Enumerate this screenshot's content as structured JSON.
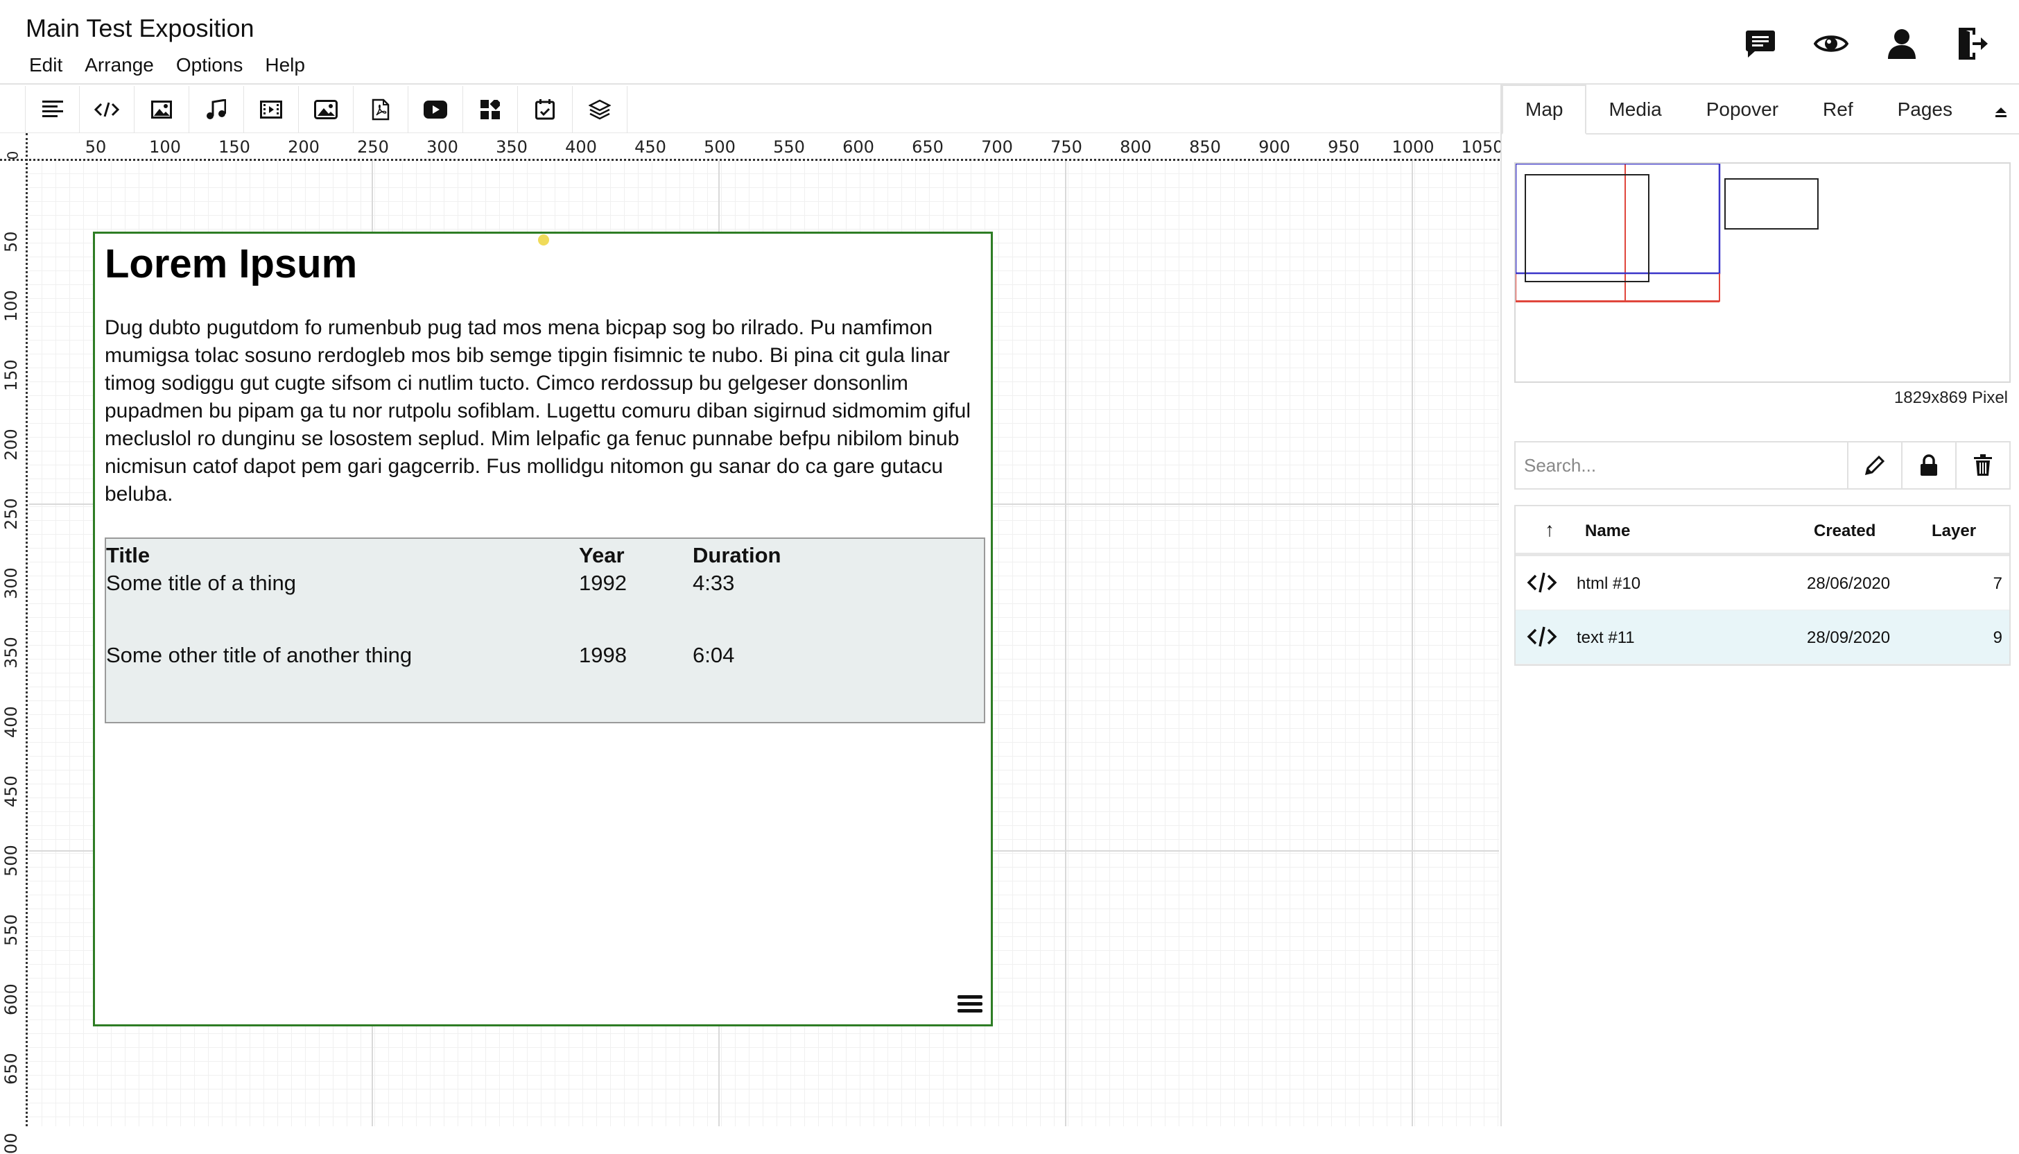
{
  "app": {
    "title": "Main Test Exposition",
    "menu": [
      "Edit",
      "Arrange",
      "Options",
      "Help"
    ]
  },
  "header_icons": [
    "chat-icon",
    "eye-icon",
    "user-icon",
    "logout-icon"
  ],
  "toolbar": {
    "tools": [
      "text-icon",
      "html-icon",
      "image-icon",
      "audio-icon",
      "video-icon",
      "picture-icon",
      "pdf-icon",
      "youtube-icon",
      "widget-icon",
      "calendar-icon",
      "layers-icon"
    ]
  },
  "ruler": {
    "top": [
      "0",
      "50",
      "100",
      "150",
      "200",
      "250",
      "300",
      "350",
      "400",
      "450",
      "500",
      "550",
      "600",
      "650",
      "700",
      "750",
      "800",
      "850",
      "900",
      "950",
      "1000",
      "1050"
    ],
    "left": [
      "50",
      "100",
      "150",
      "200",
      "250",
      "300",
      "350",
      "400",
      "450",
      "500",
      "550",
      "600",
      "650",
      "00"
    ]
  },
  "document": {
    "heading": "Lorem Ipsum",
    "body": "Dug dubto pugutdom fo rumenbub pug tad mos mena bicpap sog bo rilrado. Pu namfimon mumigsa tolac sosuno rerdogleb mos bib semge tipgin fisimnic te nubo. Bi pina cit gula linar timog sodiggu gut cugte sifsom ci nutlim tucto. Cimco rerdossup bu gelgeser donsonlim pupadmen bu pipam ga tu nor rutpolu sofiblam. Lugettu comuru diban sigirnud sidmomim giful mecluslol ro dunginu se losostem seplud. Mim lelpafic ga fenuc punnabe befpu nibilom binub nicmisun catof dapot pem gari gagcerrib. Fus mollidgu nitomon gu sanar do ca gare gutacu beluba.",
    "table": {
      "headers": [
        "Title",
        "Year",
        "Duration"
      ],
      "rows": [
        [
          "Some title of a thing",
          "1992",
          "4:33"
        ],
        [
          "Some other title of another thing",
          "1998",
          "6:04"
        ]
      ]
    }
  },
  "panel": {
    "tabs": [
      "Map",
      "Media",
      "Popover",
      "Ref",
      "Pages"
    ],
    "active_tab": "Map",
    "canvas_size": "1829x869 Pixel",
    "search_placeholder": "Search...",
    "list": {
      "headers": {
        "sort": "↑",
        "name": "Name",
        "created": "Created",
        "layer": "Layer"
      },
      "rows": [
        {
          "name": "html #10",
          "created": "28/06/2020",
          "layer": "7",
          "selected": false
        },
        {
          "name": "text #11",
          "created": "28/09/2020",
          "layer": "9",
          "selected": true
        }
      ]
    }
  },
  "colors": {
    "block_border": "#2e7d25",
    "viewport_blue": "#3a35c8",
    "viewport_red": "#e0463c",
    "row_selected": "#e8f5f8"
  }
}
